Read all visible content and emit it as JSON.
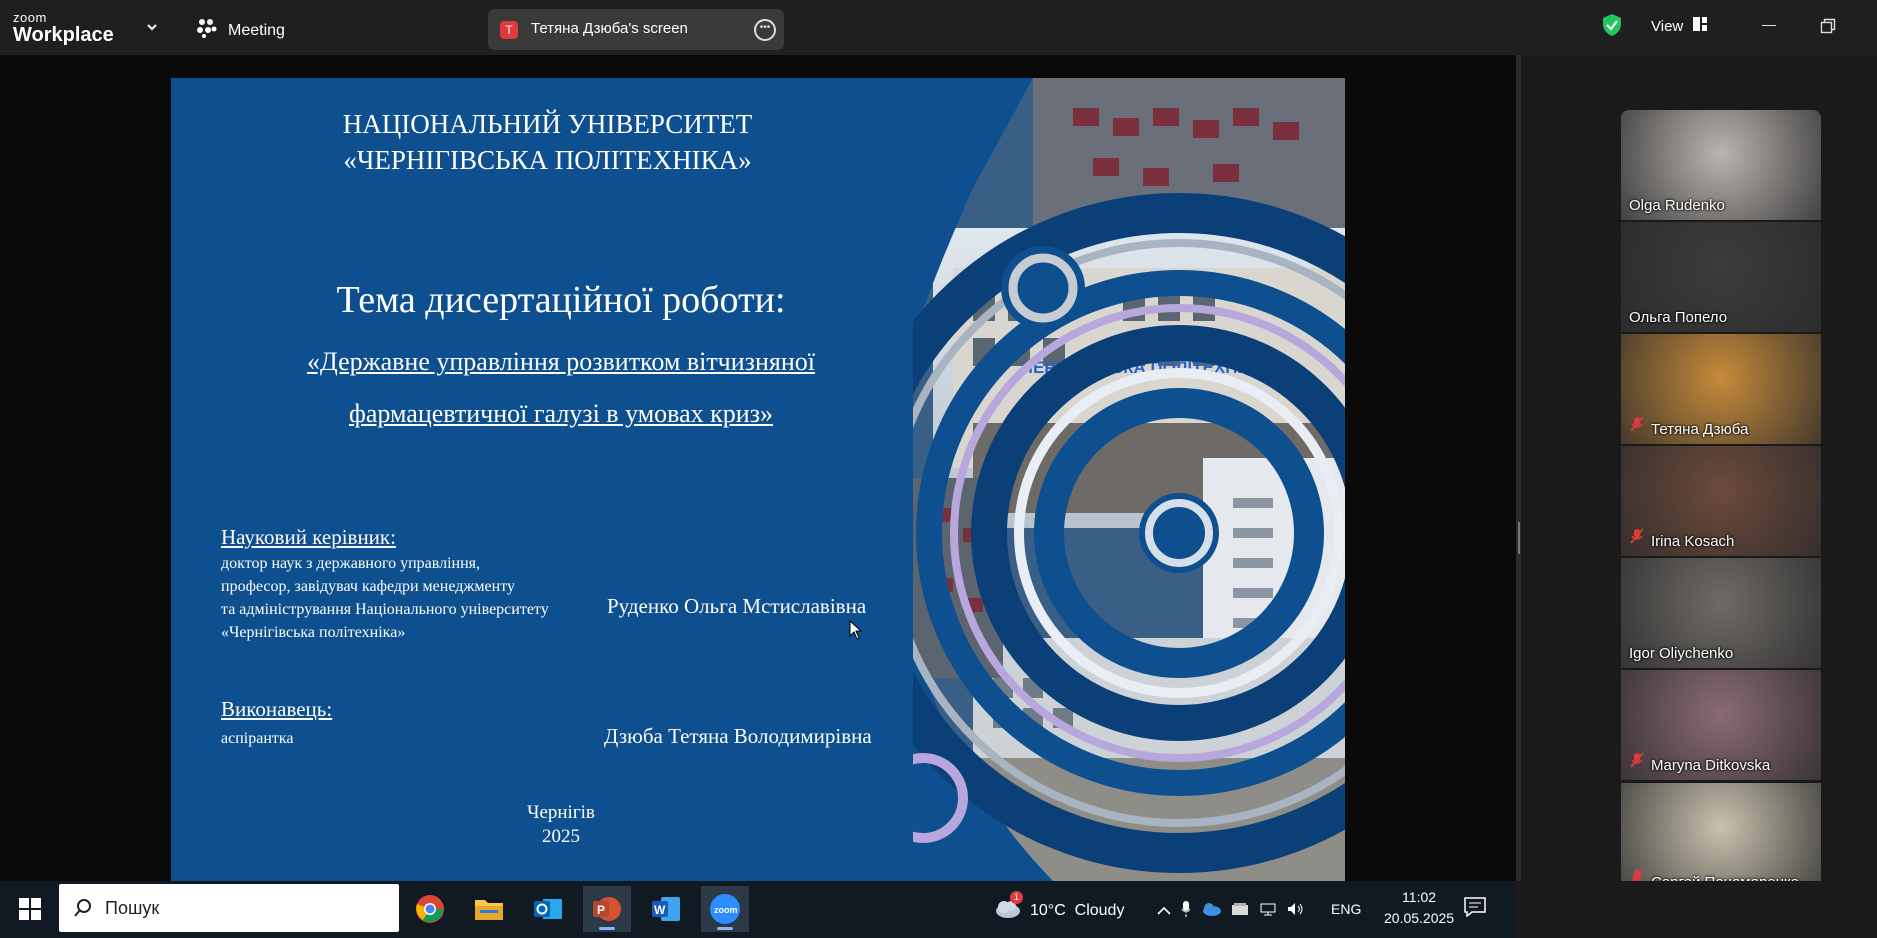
{
  "topbar": {
    "logo_small": "zoom",
    "logo_big": "Workplace",
    "meeting_label": "Meeting",
    "share_badge": "T",
    "share_label": "Тетяна Дзюба's screen",
    "view_label": "View"
  },
  "slide": {
    "university": [
      "НАЦІОНАЛЬНИЙ УНІВЕРСИТЕТ",
      "«ЧЕРНІГІВСЬКА ПОЛІТЕХНІКА»"
    ],
    "theme_title": "Тема дисертаційної роботи:",
    "theme_subtitle": [
      "«Державне управління розвитком вітчизняної",
      "фармацевтичної галузі в умовах криз»"
    ],
    "supervisor_label": "Науковий керівник:",
    "supervisor_desc": [
      "доктор наук з державного управління,",
      "професор, завідувач кафедри менеджменту",
      "та адміністрування Національного університету",
      "«Чернігівська політехніка»"
    ],
    "supervisor_name": "Руденко Ольга Мстиславівна",
    "executor_label": "Виконавець:",
    "executor_desc": "аспірантка",
    "executor_name": "Дзюба Тетяна Володимирівна",
    "city": "Чернігів",
    "year": "2025",
    "building_sign": "ЧЕРНІГІВСЬКА ПОЛІТЕХНІКА»"
  },
  "participants": [
    {
      "name": "Olga Rudenko",
      "muted": false,
      "active": false,
      "bg": "#b9b4b0"
    },
    {
      "name": "Ольга Попело",
      "muted": false,
      "active": true,
      "bg": "#3d3a3a"
    },
    {
      "name": "Тетяна Дзюба",
      "muted": true,
      "active": false,
      "bg": "#c78a3a"
    },
    {
      "name": "Irina Kosach",
      "muted": true,
      "active": false,
      "bg": "#6c4a3a"
    },
    {
      "name": "Igor Oliychenko",
      "muted": false,
      "active": false,
      "bg": "#6e6a66"
    },
    {
      "name": "Maryna Ditkovska",
      "muted": true,
      "active": false,
      "bg": "#8a6a76"
    },
    {
      "name": "Сергей Пономаренко",
      "muted": true,
      "active": false,
      "bg": "#c9c2ae"
    }
  ],
  "taskbar": {
    "search_label": "Пошук",
    "weather": "10°C  Cloudy",
    "weather_badge": "1",
    "lang": "ENG",
    "time": "11:02",
    "date": "20.05.2025",
    "apps": [
      "chrome-icon",
      "file-explorer-icon",
      "outlook-icon",
      "powerpoint-icon",
      "word-icon",
      "zoom-icon"
    ]
  },
  "colors": {
    "slide_bg": "#0d4f8f",
    "active_tile_border": "#22d36a",
    "muted_red": "#e0393e"
  }
}
